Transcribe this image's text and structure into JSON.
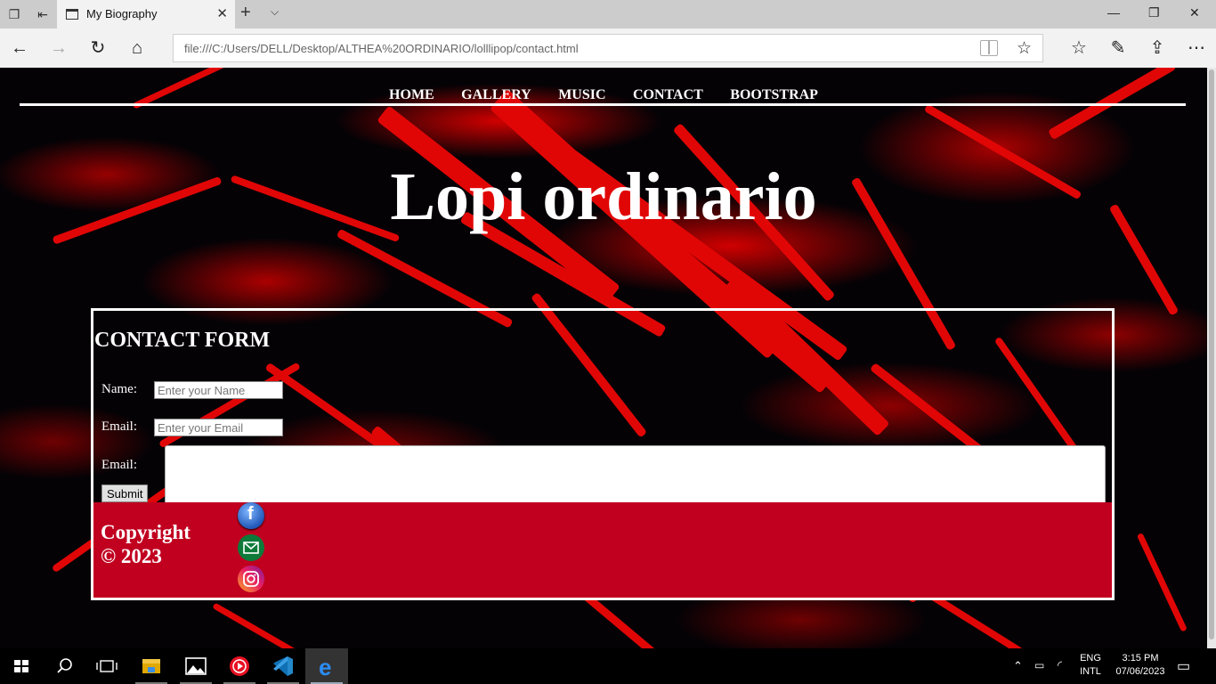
{
  "browser": {
    "tab_title": "My Biography",
    "address": "file:///C:/Users/DELL/Desktop/ALTHEA%20ORDINARIO/lolllipop/contact.html"
  },
  "site": {
    "nav": [
      "HOME",
      "GALLERY",
      "MUSIC",
      "CONTACT",
      "BOOTSTRAP"
    ],
    "title": "Lopi ordinario"
  },
  "contact_form": {
    "heading": "CONTACT FORM",
    "name_label": "Name:",
    "name_placeholder": "Enter your Name",
    "email_label": "Email:",
    "email_placeholder": "Enter your Email",
    "message_label": "Email:",
    "submit_label": "Submit"
  },
  "footer": {
    "copyright_line1": "Copyright",
    "copyright_line2": "© 2023",
    "social_icons": [
      "facebook-icon",
      "mail-icon",
      "instagram-icon"
    ],
    "background": "#c10020"
  },
  "taskbar": {
    "language_line1": "ENG",
    "language_line2": "INTL",
    "time": "3:15 PM",
    "date": "07/06/2023"
  }
}
